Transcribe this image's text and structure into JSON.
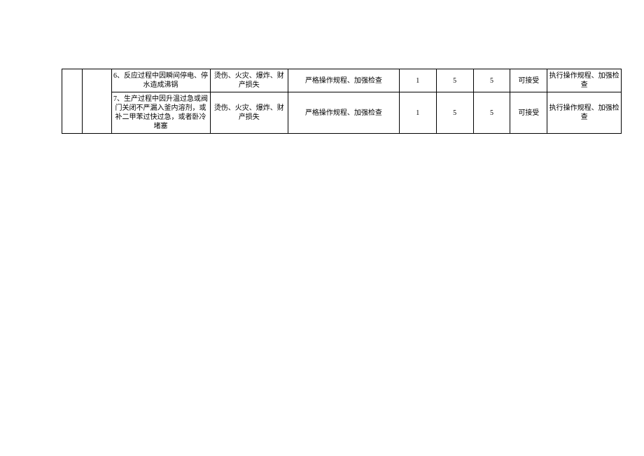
{
  "table": {
    "rows": [
      {
        "blank1": "",
        "blank2": "",
        "desc": "6、反应过程中因瞬间停电、停水造成沸锅",
        "hazard": "烫伤、火灾、爆炸、财产损失",
        "measure": "严格操作规程、加强检查",
        "num1": "1",
        "num2": "5",
        "num3": "5",
        "accept": "可接受",
        "action": "执行操作规程、加强检查"
      },
      {
        "blank1": "",
        "blank2": "",
        "desc": "7、生产过程中因升温过急或阀门关闭不严漏入釜内溶剂，或补二甲苯过快过急，或者卧冷堵塞",
        "hazard": "烫伤、火灾、爆炸、财产损失",
        "measure": "严格操作规程、加强检查",
        "num1": "1",
        "num2": "5",
        "num3": "5",
        "accept": "可接受",
        "action": "执行操作规程、加强检查"
      }
    ]
  }
}
